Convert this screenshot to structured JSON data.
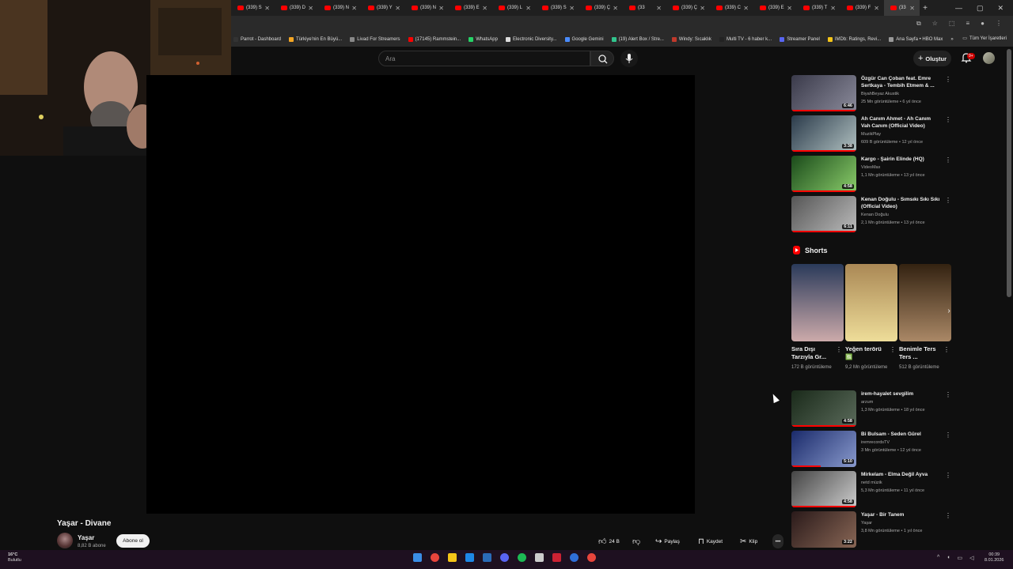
{
  "browser": {
    "tabs": [
      {
        "label": "(339) S"
      },
      {
        "label": "(339) D"
      },
      {
        "label": "(339) N"
      },
      {
        "label": "(339) Y"
      },
      {
        "label": "(339) N"
      },
      {
        "label": "(339) E"
      },
      {
        "label": "(339) L"
      },
      {
        "label": "(339) S"
      },
      {
        "label": "(339) Ç"
      },
      {
        "label": "(33"
      },
      {
        "label": "(339) Ç"
      },
      {
        "label": "(339) C"
      },
      {
        "label": "(339) E"
      },
      {
        "label": "(339) T"
      },
      {
        "label": "(339) F"
      },
      {
        "label": "(33"
      }
    ],
    "new_tab": "+",
    "close_glyph": "✕"
  },
  "bookmarks": [
    {
      "label": "Parrot - Dashboard",
      "color": "#333333"
    },
    {
      "label": "Türkiye'nin En Büyü...",
      "color": "#f5a623"
    },
    {
      "label": "Livad For Streamers",
      "color": "#888888"
    },
    {
      "label": "(17145) Rammstein...",
      "color": "#ff0000"
    },
    {
      "label": "WhatsApp",
      "color": "#25d366"
    },
    {
      "label": "Electronic Diversity...",
      "color": "#dddddd"
    },
    {
      "label": "Google Gemini",
      "color": "#4a8cff"
    },
    {
      "label": "(19) Alert Box / Stre...",
      "color": "#31c48d"
    },
    {
      "label": "Windy: Sıcaklık",
      "color": "#c0392b"
    },
    {
      "label": "Multi TV - 6 haber k...",
      "color": "#222222"
    },
    {
      "label": "Streamer Panel",
      "color": "#5865f2"
    },
    {
      "label": "IMDb: Ratings, Revi...",
      "color": "#f5c518"
    },
    {
      "label": "Ana Sayfa • HBO Max",
      "color": "#999999"
    }
  ],
  "bookmarks_overflow": "»",
  "bookmarks_all": "Tüm Yer İşaretleri",
  "header": {
    "search_placeholder": "Ara",
    "create_label": "Oluştur",
    "notif_badge": "9+"
  },
  "video": {
    "title": "Yaşar - Divane",
    "channel": "Yaşar",
    "subscribers": "8,82 B abone",
    "subscribe_label": "Abone ol",
    "likes": "24 B",
    "share_label": "Paylaş",
    "save_label": "Kaydet",
    "clip_label": "Klip",
    "more_glyph": "•••"
  },
  "sidebar_top": [
    {
      "title": "Özgür Can Çoban feat. Emre Sertkaya - Tembih Etmem & ...",
      "channel": "BiyahBeyaz Akustik",
      "meta": "25 Mn görüntüleme • 6 yıl önce",
      "duration": "6:46",
      "colors": [
        "#3a3a4a",
        "#8a8a9a"
      ],
      "progress": 1.0
    },
    {
      "title": "Ah Canım Ahmet - Ah Canım Vah Canım (Official Video)",
      "channel": "MuzikPlay",
      "meta": "609 B görüntüleme • 12 yıl önce",
      "duration": "3:38",
      "colors": [
        "#2a3a4a",
        "#b0c0c0"
      ],
      "progress": 1.0
    },
    {
      "title": "Kargo - Şairin Elinde (HQ)",
      "channel": "VideoMax",
      "meta": "1,1 Mn görüntüleme • 13 yıl önce",
      "duration": "4:58",
      "colors": [
        "#1a4a1a",
        "#8acc6a"
      ],
      "progress": 1.0
    },
    {
      "title": "Kenan Doğulu - Sımsıkı Sıkı Sıkı (Official Video)",
      "channel": "Kenan Doğulu",
      "meta": "2,1 Mn görüntüleme • 13 yıl önce",
      "duration": "6:11",
      "colors": [
        "#555555",
        "#bbbbbb"
      ],
      "progress": 1.0
    }
  ],
  "shorts_heading": "Shorts",
  "shorts": [
    {
      "title": "Sıra Dışı Tarzıyla Gr...",
      "views": "172 B görüntüleme",
      "colors": [
        "#2a3a5a",
        "#caa"
      ]
    },
    {
      "title": "Yeğen terörü 🈯",
      "views": "9,2 Mn görüntüleme",
      "colors": [
        "#aa8855",
        "#eedd99"
      ]
    },
    {
      "title": "Benimle Ters Ters ...",
      "views": "512 B görüntüleme",
      "colors": [
        "#332211",
        "#aa8866"
      ]
    }
  ],
  "sidebar_bottom": [
    {
      "title": "irem-hayalet sevgilim",
      "channel": "arzum",
      "meta": "1,3 Mn görüntüleme • 18 yıl önce",
      "duration": "4:58",
      "colors": [
        "#1a2a1a",
        "#5a6a5a"
      ],
      "progress": 1.0
    },
    {
      "title": "Bi Bulsam - Seden Gürel",
      "channel": "iremrecordsTV",
      "meta": "3 Mn görüntüleme • 12 yıl önce",
      "duration": "5:10",
      "colors": [
        "#1a2a6a",
        "#8899cc"
      ],
      "progress": 0.45
    },
    {
      "title": "Mirkelam - Elma Değil Ayva",
      "channel": "netd müzik",
      "meta": "5,3 Mn görüntüleme • 11 yıl önce",
      "duration": "4:58",
      "colors": [
        "#444444",
        "#cccccc"
      ],
      "progress": 1.0
    },
    {
      "title": "Yaşar - Bir Tanem",
      "channel": "Yaşar",
      "meta": "3,8 Mn görüntüleme • 1 yıl önce",
      "duration": "3:22",
      "colors": [
        "#2a1a1a",
        "#886655"
      ],
      "progress": 0.0
    }
  ],
  "taskbar": {
    "weather_temp": "16°C",
    "weather_desc": "Bulutlu",
    "time": "00:39",
    "date": "8.01.2026",
    "app_colors": [
      "#3a8ee6",
      "#e8453c",
      "#f5c518",
      "#1e88e5",
      "#2a6cb8",
      "#5865f2",
      "#1db954",
      "#cccccc",
      "#cc2233",
      "#2f6fd9",
      "#e8453c"
    ]
  }
}
